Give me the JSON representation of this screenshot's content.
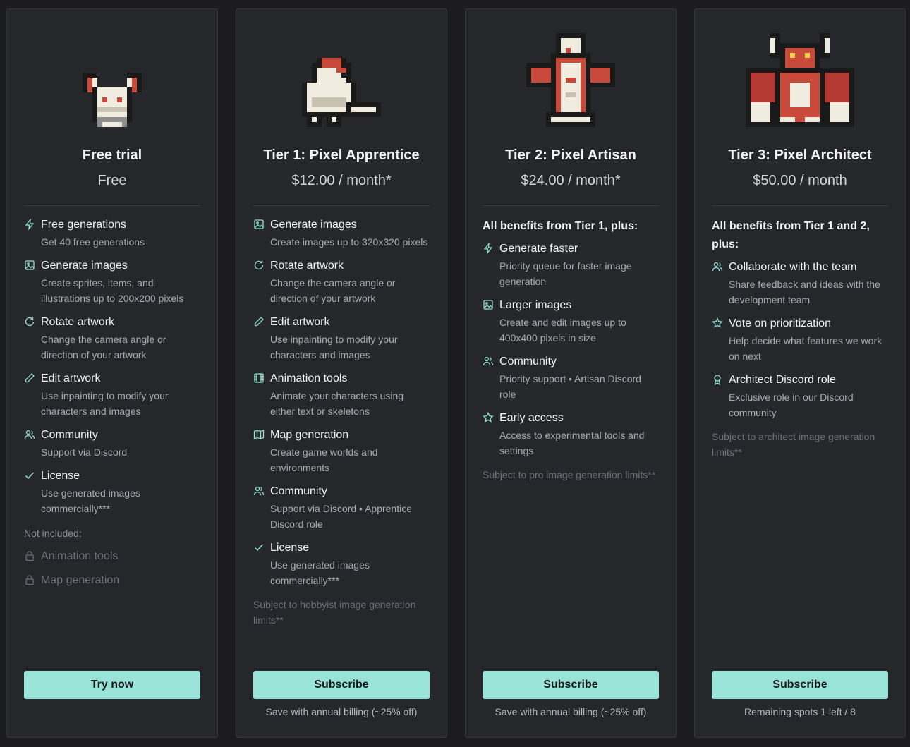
{
  "colors": {
    "accent": "#9ae3d8",
    "card_bg": "#26272a",
    "page_bg": "#1c1c1e",
    "muted": "#6d7077"
  },
  "plans": [
    {
      "title": "Free trial",
      "price": "Free",
      "features": [
        {
          "icon": "lightning-icon",
          "title": "Free generations",
          "desc": "Get 40 free generations"
        },
        {
          "icon": "image-icon",
          "title": "Generate images",
          "desc": "Create sprites, items, and illustrations up to 200x200 pixels"
        },
        {
          "icon": "rotate-icon",
          "title": "Rotate artwork",
          "desc": "Change the camera angle or direction of your artwork"
        },
        {
          "icon": "pencil-icon",
          "title": "Edit artwork",
          "desc": "Use inpainting to modify your characters and images"
        },
        {
          "icon": "users-icon",
          "title": "Community",
          "desc": "Support via Discord"
        },
        {
          "icon": "check-icon",
          "title": "License",
          "desc": "Use generated images commercially***"
        }
      ],
      "excluded_label": "Not included:",
      "excluded": [
        "Animation tools",
        "Map generation"
      ],
      "button": "Try now"
    },
    {
      "title": "Tier 1: Pixel Apprentice",
      "price": "$12.00 / month*",
      "features": [
        {
          "icon": "image-icon",
          "title": "Generate images",
          "desc": "Create images up to 320x320 pixels"
        },
        {
          "icon": "rotate-icon",
          "title": "Rotate artwork",
          "desc": "Change the camera angle or direction of your artwork"
        },
        {
          "icon": "pencil-icon",
          "title": "Edit artwork",
          "desc": "Use inpainting to modify your characters and images"
        },
        {
          "icon": "film-icon",
          "title": "Animation tools",
          "desc": "Animate your characters using either text or skeletons"
        },
        {
          "icon": "map-icon",
          "title": "Map generation",
          "desc": "Create game worlds and environments"
        },
        {
          "icon": "users-icon",
          "title": "Community",
          "desc": "Support via Discord • Apprentice Discord role"
        },
        {
          "icon": "check-icon",
          "title": "License",
          "desc": "Use generated images commercially***"
        }
      ],
      "note": "Subject to hobbyist image generation limits**",
      "button": "Subscribe",
      "footer": "Save with annual billing (~25% off)"
    },
    {
      "title": "Tier 2: Pixel Artisan",
      "price": "$24.00 / month*",
      "intro": "All benefits from Tier 1, plus:",
      "features": [
        {
          "icon": "lightning-icon",
          "title": "Generate faster",
          "desc": "Priority queue for faster image generation"
        },
        {
          "icon": "image-icon",
          "title": "Larger images",
          "desc": "Create and edit images up to 400x400 pixels in size"
        },
        {
          "icon": "users-icon",
          "title": "Community",
          "desc": "Priority support • Artisan Discord role"
        },
        {
          "icon": "star-icon",
          "title": "Early access",
          "desc": "Access to experimental tools and settings"
        }
      ],
      "note": "Subject to pro image generation limits**",
      "button": "Subscribe",
      "footer": "Save with annual billing (~25% off)"
    },
    {
      "title": "Tier 3: Pixel Architect",
      "price": "$50.00 / month",
      "intro": "All benefits from Tier 1 and 2, plus:",
      "features": [
        {
          "icon": "users-icon",
          "title": "Collaborate with the team",
          "desc": "Share feedback and ideas with the development team"
        },
        {
          "icon": "star-icon",
          "title": "Vote on prioritization",
          "desc": "Help decide what features we work on next"
        },
        {
          "icon": "award-icon",
          "title": "Architect Discord role",
          "desc": "Exclusive role in our Discord community"
        }
      ],
      "note": "Subject to architect image generation limits**",
      "button": "Subscribe",
      "footer": "Remaining spots 1 left / 8"
    }
  ]
}
